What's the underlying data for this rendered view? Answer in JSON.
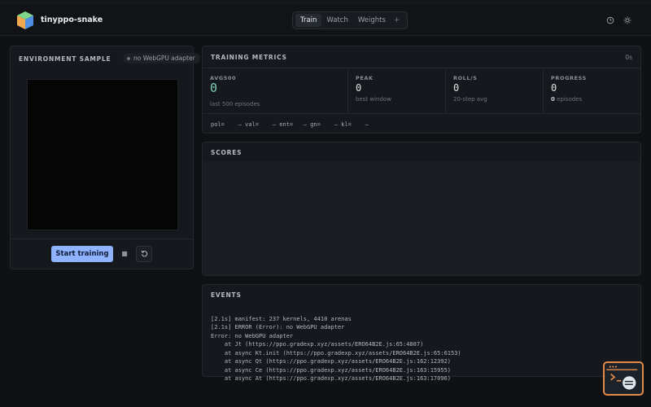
{
  "app": {
    "title": "tinyppo-snake"
  },
  "tabs": [
    {
      "label": "Train",
      "active": true
    },
    {
      "label": "Watch",
      "active": false
    },
    {
      "label": "Weights",
      "active": false
    }
  ],
  "tab_add_label": "+",
  "header_icons": [
    "clock-icon",
    "sun-icon"
  ],
  "environment": {
    "title": "ENVIRONMENT SAMPLE",
    "badge": "no WebGPU adapter",
    "start_button": "Start training",
    "stop_icon": "stop-icon",
    "reset_icon": "reset-icon"
  },
  "metrics": {
    "title": "TRAINING METRICS",
    "elapsed": "0s",
    "cards": [
      {
        "label": "AVG500",
        "value": "0",
        "sub": "last 500 episodes"
      },
      {
        "label": "PEAK",
        "value": "0",
        "sub": "best window"
      },
      {
        "label": "ROLL/S",
        "value": "0",
        "sub": "20-step avg"
      },
      {
        "label": "PROGRESS",
        "value": "0",
        "sub_count": "0",
        "sub": "episodes"
      }
    ],
    "stats": "pol=    – val=    – ent=   – gn=    – kl=    –"
  },
  "scores": {
    "title": "SCORES"
  },
  "events": {
    "title": "EVENTS",
    "lines": [
      "[2.1s] manifest: 237 kernels, 4410 arenas",
      "[2.1s] ERROR (Error): no WebGPU adapter",
      "Error: no WebGPU adapter",
      "    at Jt (https://ppo.gradexp.xyz/assets/ERO64B2E.js:65:4807)",
      "    at async Kt.init (https://ppo.gradexp.xyz/assets/ERO64B2E.js:65:6153)",
      "    at async Qt (https://ppo.gradexp.xyz/assets/ERO64B2E.js:162:12392)",
      "    at async Ce (https://ppo.gradexp.xyz/assets/ERO64B2E.js:163:15955)",
      "    at async At (https://ppo.gradexp.xyz/assets/ERO64B2E.js:163:17096)"
    ]
  },
  "colors": {
    "accent": "#8fb3ff",
    "metric_highlight": "#7fd0b4",
    "background": "#0f1114",
    "panel": "#15181c",
    "fab_border": "#e38b46"
  }
}
